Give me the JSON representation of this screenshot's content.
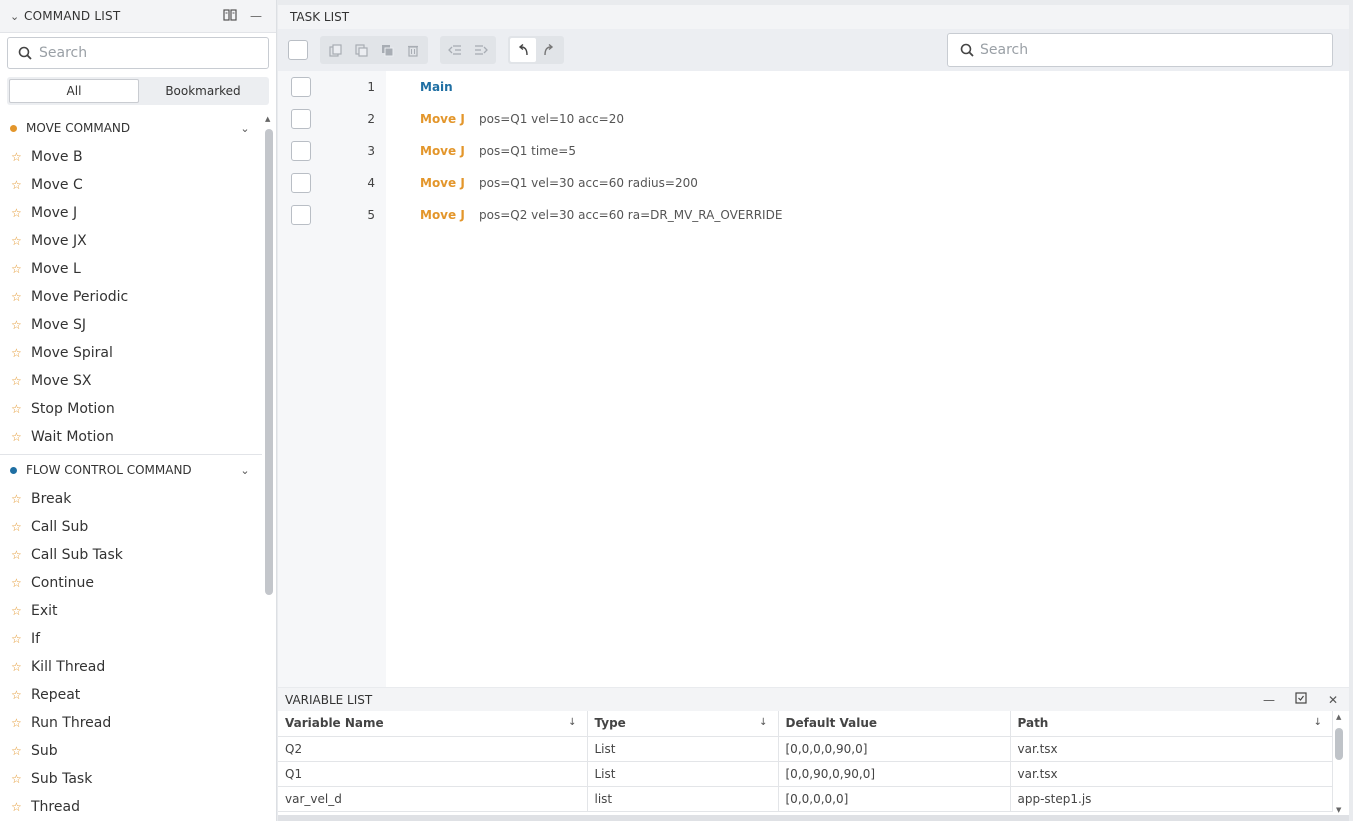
{
  "command_list": {
    "title": "COMMAND LIST",
    "search_placeholder": "Search",
    "tabs": [
      "All",
      "Bookmarked"
    ],
    "groups": [
      {
        "title": "MOVE COMMAND",
        "dot_color": "#e3962b",
        "items": [
          "Move B",
          "Move C",
          "Move J",
          "Move JX",
          "Move L",
          "Move Periodic",
          "Move SJ",
          "Move Spiral",
          "Move SX",
          "Stop Motion",
          "Wait Motion"
        ]
      },
      {
        "title": "FLOW CONTROL COMMAND",
        "dot_color": "#1f6fa3",
        "items": [
          "Break",
          "Call Sub",
          "Call Sub Task",
          "Continue",
          "Exit",
          "If",
          "Kill Thread",
          "Repeat",
          "Run Thread",
          "Sub",
          "Sub Task",
          "Thread"
        ]
      }
    ]
  },
  "task_list": {
    "title": "TASK LIST",
    "search_placeholder": "Search",
    "rows": [
      {
        "num": "1",
        "cmd": "Main",
        "args": "",
        "kind": "main"
      },
      {
        "num": "2",
        "cmd": "Move J",
        "args": "pos=Q1 vel=10 acc=20",
        "kind": "move"
      },
      {
        "num": "3",
        "cmd": "Move J",
        "args": "pos=Q1 time=5",
        "kind": "move"
      },
      {
        "num": "4",
        "cmd": "Move J",
        "args": "pos=Q1 vel=30 acc=60 radius=200",
        "kind": "move"
      },
      {
        "num": "5",
        "cmd": "Move J",
        "args": "pos=Q2 vel=30 acc=60 ra=DR_MV_RA_OVERRIDE",
        "kind": "move"
      }
    ]
  },
  "variable_list": {
    "title": "VARIABLE LIST",
    "columns": [
      "Variable Name",
      "Type",
      "Default Value",
      "Path"
    ],
    "rows": [
      [
        "Q2",
        "List",
        "[0,0,0,0,90,0]",
        "var.tsx"
      ],
      [
        "Q1",
        "List",
        "[0,0,90,0,90,0]",
        "var.tsx"
      ],
      [
        "var_vel_d",
        "list",
        "[0,0,0,0,0]",
        "app-step1.js"
      ]
    ]
  }
}
